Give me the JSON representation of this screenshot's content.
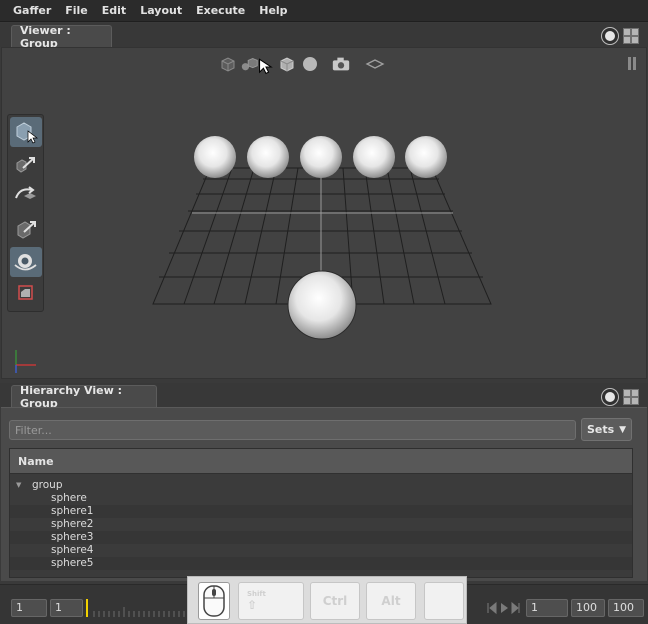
{
  "menu": [
    "Gaffer",
    "File",
    "Edit",
    "Layout",
    "Execute",
    "Help"
  ],
  "viewer": {
    "tab_title": "Viewer : Group"
  },
  "hierarchy": {
    "tab_title": "Hierarchy View : Group",
    "filter_placeholder": "Filter...",
    "sets_label": "Sets",
    "column_name": "Name",
    "root": "group",
    "children": [
      "sphere",
      "sphere1",
      "sphere2",
      "sphere3",
      "sphere4",
      "sphere5"
    ]
  },
  "timeline": {
    "start_frame": "1",
    "current_frame": "1",
    "playback_frame": "1",
    "end_frame": "100",
    "range_end": "100"
  },
  "keys": {
    "shift": "Shift",
    "ctrl": "Ctrl",
    "alt": "Alt"
  },
  "colors": {
    "accent": "#5a6b78",
    "background": "#3a3a3a",
    "playhead": "#f2d100"
  }
}
